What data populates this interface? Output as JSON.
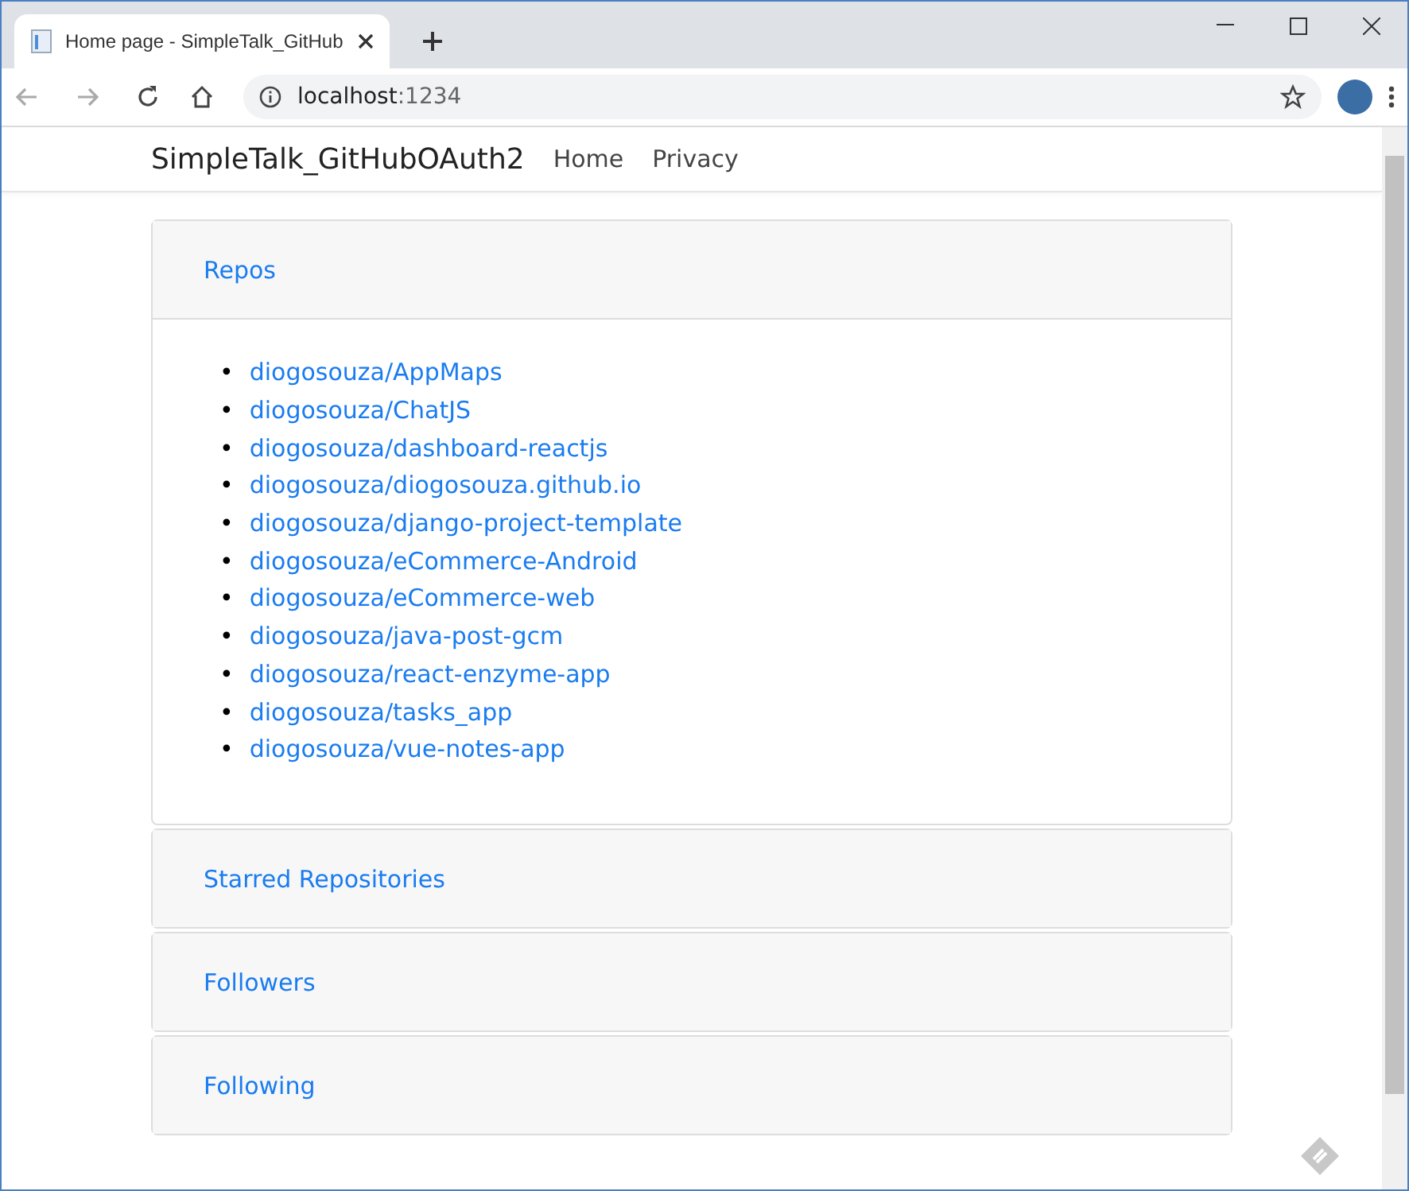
{
  "browser": {
    "tab_title": "Home page - SimpleTalk_GitHub",
    "address_host": "localhost",
    "address_port": ":1234"
  },
  "navbar": {
    "brand": "SimpleTalk_GitHubOAuth2",
    "links": [
      "Home",
      "Privacy"
    ]
  },
  "accordion": [
    {
      "title": "Repos",
      "expanded": true,
      "items": [
        {
          "marker": "•",
          "text": "diogosouza/AppMaps"
        },
        {
          "marker": "•",
          "text": "diogosouza/ChatJS"
        },
        {
          "marker": "•",
          "text": "diogosouza/dashboard-reactjs"
        },
        {
          "marker": "•",
          "text": "diogosouza/diogosouza.github.io"
        },
        {
          "marker": "•",
          "text": "diogosouza/django-project-template"
        },
        {
          "marker": "•",
          "text": "diogosouza/eCommerce-Android"
        },
        {
          "marker": "•",
          "text": "diogosouza/eCommerce-web"
        },
        {
          "marker": "•",
          "text": "diogosouza/java-post-gcm"
        },
        {
          "marker": "•",
          "text": "diogosouza/react-enzyme-app"
        },
        {
          "marker": "•",
          "text": "diogosouza/tasks_app"
        },
        {
          "marker": "•",
          "text": "diogosouza/vue-notes-app"
        }
      ]
    },
    {
      "title": "Starred Repositories",
      "expanded": false
    },
    {
      "title": "Followers",
      "expanded": false
    },
    {
      "title": "Following",
      "expanded": false
    }
  ]
}
